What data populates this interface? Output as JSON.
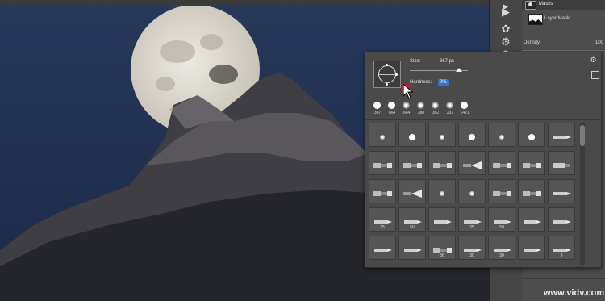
{
  "photo": {
    "alt": "",
    "sky_color": "#233456",
    "moon_color": "#d8d4cb",
    "rock_color": "#3a3a40"
  },
  "properties_panel": {
    "masks_label": "Masks",
    "layer_mask_label": "Layer Mask",
    "density_label": "Density:",
    "density_value": "100"
  },
  "brush_popup": {
    "size_label": "Size:",
    "size_value": "367 px",
    "hardness_label": "Hardness:",
    "hardness_value": "0%",
    "recent_sizes": [
      "367",
      "664",
      "664",
      "388",
      "362",
      "237",
      "1421"
    ],
    "grid_rows": [
      [
        "",
        "",
        "",
        "",
        "",
        "",
        ""
      ],
      [
        "",
        "",
        "",
        "",
        "",
        "",
        ""
      ],
      [
        "",
        "",
        "",
        "",
        "",
        "",
        ""
      ],
      [
        "25",
        "50",
        "",
        "25",
        "50",
        "",
        ""
      ],
      [
        "",
        "",
        "36",
        "30",
        "30",
        "",
        "9"
      ]
    ]
  },
  "watermark": "www.vidv.com",
  "colors": {
    "accent": "#3d6fc4",
    "panel": "#4a4a4a",
    "cursor_glow": "#c0143c"
  }
}
